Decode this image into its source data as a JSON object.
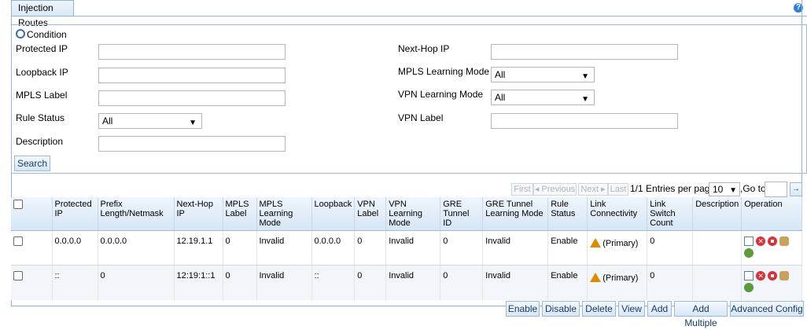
{
  "tab": {
    "title": "Injection Routes"
  },
  "help_icon": "?",
  "condition": {
    "title": "Condition",
    "fields": {
      "protected_ip": "Protected IP",
      "loopback_ip": "Loopback IP",
      "mpls_label": "MPLS Label",
      "rule_status": "Rule Status",
      "rule_status_value": "All",
      "description": "Description",
      "next_hop_ip": "Next-Hop IP",
      "mpls_learning_mode": "MPLS Learning Mode",
      "mpls_learning_mode_value": "All",
      "vpn_learning_mode": "VPN Learning Mode",
      "vpn_learning_mode_value": "All",
      "vpn_label": "VPN Label"
    },
    "search_button": "Search"
  },
  "pager": {
    "first": "First",
    "previous": "◂ Previous",
    "next": "Next ▸",
    "last": "Last",
    "page_info": "1/1",
    "entries_label": "Entries per page",
    "entries_value": "10",
    "goto_label": ",Go to",
    "goto_value": "",
    "go_button": "→"
  },
  "table": {
    "headers": {
      "protected_ip": "Protected IP",
      "prefix": "Prefix Length/Netmask",
      "next_hop": "Next-Hop IP",
      "mpls_label": "MPLS Label",
      "mpls_mode": "MPLS Learning Mode",
      "loopback": "Loopback",
      "vpn_label": "VPN Label",
      "vpn_mode": "VPN Learning Mode",
      "gre_id": "GRE Tunnel ID",
      "gre_mode": "GRE Tunnel Learning Mode",
      "rule_status": "Rule Status",
      "link_conn": "Link Connectivity",
      "link_switch": "Link Switch Count",
      "description": "Description",
      "operation": "Operation"
    },
    "rows": [
      {
        "protected_ip": "0.0.0.0",
        "prefix": "0.0.0.0",
        "next_hop": "12.19.1.1",
        "mpls_label": "0",
        "mpls_mode": "Invalid",
        "loopback": "0.0.0.0",
        "vpn_label": "0",
        "vpn_mode": "Invalid",
        "gre_id": "0",
        "gre_mode": "Invalid",
        "rule_status": "Enable",
        "link_conn": "(Primary)",
        "link_switch": "0",
        "description": ""
      },
      {
        "protected_ip": "::",
        "prefix": "0",
        "next_hop": "12:19:1::1",
        "mpls_label": "0",
        "mpls_mode": "Invalid",
        "loopback": "::",
        "vpn_label": "0",
        "vpn_mode": "Invalid",
        "gre_id": "0",
        "gre_mode": "Invalid",
        "rule_status": "Enable",
        "link_conn": "(Primary)",
        "link_switch": "0",
        "description": ""
      }
    ]
  },
  "actions": {
    "enable": "Enable",
    "disable": "Disable",
    "delete": "Delete",
    "view": "View",
    "add": "Add",
    "add_multiple": "Add Multiple",
    "advanced_config": "Advanced Config"
  }
}
